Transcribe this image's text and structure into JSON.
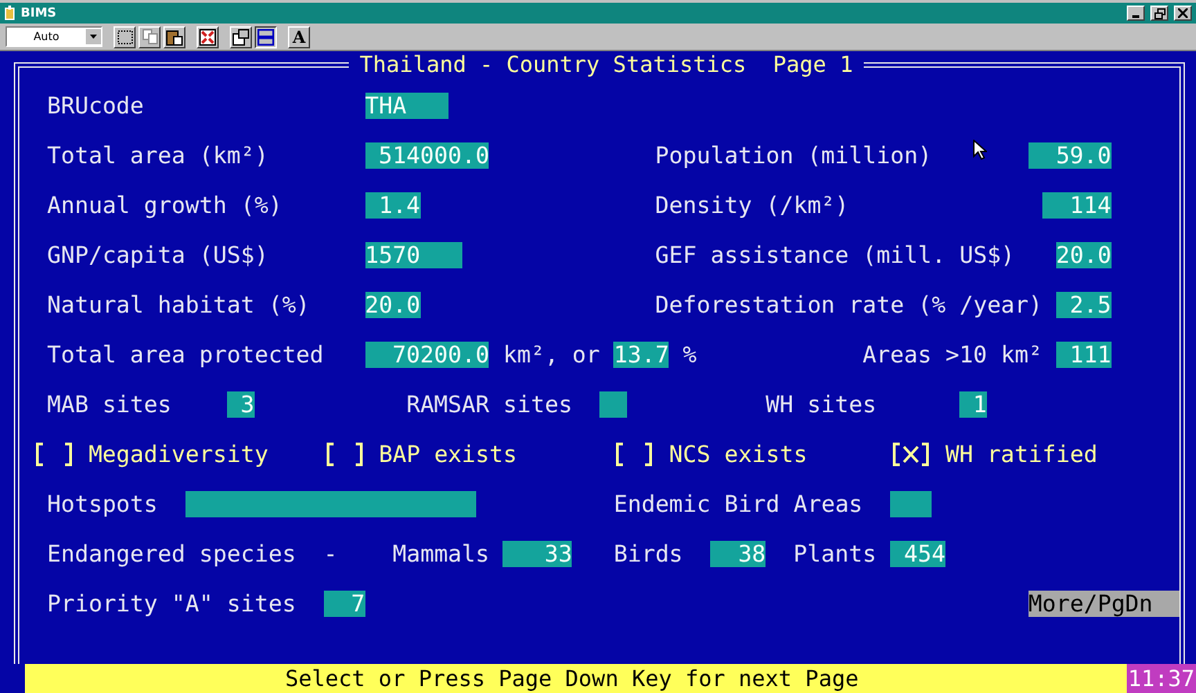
{
  "window": {
    "title": "BIMS"
  },
  "toolbar": {
    "font_size": "Auto",
    "font_button": "A"
  },
  "screen": {
    "title": "Thailand - Country Statistics  Page 1",
    "rows": [
      {
        "items": [
          {
            "kind": "label",
            "text": "BRUcode"
          },
          {
            "kind": "field",
            "value": "THA"
          }
        ]
      },
      {
        "items": [
          {
            "kind": "label",
            "text": "Total area (km²)"
          },
          {
            "kind": "field",
            "value": "514000.0"
          },
          {
            "kind": "label",
            "text": "Population (million)"
          },
          {
            "kind": "field",
            "value": "59.0"
          }
        ]
      },
      {
        "items": [
          {
            "kind": "label",
            "text": "Annual growth (%)"
          },
          {
            "kind": "field",
            "value": "1.4"
          },
          {
            "kind": "label",
            "text": "Density (/km²)"
          },
          {
            "kind": "field",
            "value": "114"
          }
        ]
      },
      {
        "items": [
          {
            "kind": "label",
            "text": "GNP/capita (US$)"
          },
          {
            "kind": "field",
            "value": "1570"
          },
          {
            "kind": "label",
            "text": "GEF assistance (mill. US$)"
          },
          {
            "kind": "field",
            "value": "20.0"
          }
        ]
      },
      {
        "items": [
          {
            "kind": "label",
            "text": "Natural habitat (%)"
          },
          {
            "kind": "field",
            "value": "20.0"
          },
          {
            "kind": "label",
            "text": "Deforestation rate (% /year)"
          },
          {
            "kind": "field",
            "value": "2.5"
          }
        ]
      },
      {
        "items": [
          {
            "kind": "label",
            "text": "Total area protected"
          },
          {
            "kind": "field",
            "value": "70200.0"
          },
          {
            "kind": "label",
            "text": "km², or"
          },
          {
            "kind": "field",
            "value": "13.7"
          },
          {
            "kind": "label",
            "text": "%"
          },
          {
            "kind": "label",
            "text": "Areas >10 km²"
          },
          {
            "kind": "field",
            "value": "111"
          }
        ]
      },
      {
        "items": [
          {
            "kind": "label",
            "text": "MAB sites"
          },
          {
            "kind": "field",
            "value": "3"
          },
          {
            "kind": "label",
            "text": "RAMSAR sites"
          },
          {
            "kind": "field"
          },
          {
            "kind": "label",
            "text": "WH sites"
          },
          {
            "kind": "field",
            "value": "1"
          }
        ]
      },
      {
        "items": [
          {
            "kind": "checkbox",
            "text": "Megadiversity",
            "checked": false
          },
          {
            "kind": "checkbox",
            "text": "BAP exists",
            "checked": false
          },
          {
            "kind": "checkbox",
            "text": "NCS exists",
            "checked": false
          },
          {
            "kind": "checkbox",
            "text": "WH ratified",
            "checked": true
          }
        ]
      },
      {
        "items": [
          {
            "kind": "label",
            "text": "Hotspots"
          },
          {
            "kind": "field"
          },
          {
            "kind": "label",
            "text": "Endemic Bird Areas"
          },
          {
            "kind": "field"
          }
        ]
      },
      {
        "items": [
          {
            "kind": "label",
            "text": "Endangered species  -"
          },
          {
            "kind": "label",
            "text": "Mammals"
          },
          {
            "kind": "field",
            "value": "33"
          },
          {
            "kind": "label",
            "text": "Birds"
          },
          {
            "kind": "field",
            "value": "38"
          },
          {
            "kind": "label",
            "text": "Plants"
          },
          {
            "kind": "field",
            "value": "454"
          }
        ]
      },
      {
        "items": [
          {
            "kind": "label",
            "text": "Priority \"A\" sites"
          },
          {
            "kind": "field",
            "value": "7"
          },
          {
            "kind": "key",
            "text": "More/PgDn"
          }
        ]
      }
    ]
  },
  "status_bar": {
    "message": "Select or Press Page Down Key for next Page",
    "clock": "11:37"
  }
}
